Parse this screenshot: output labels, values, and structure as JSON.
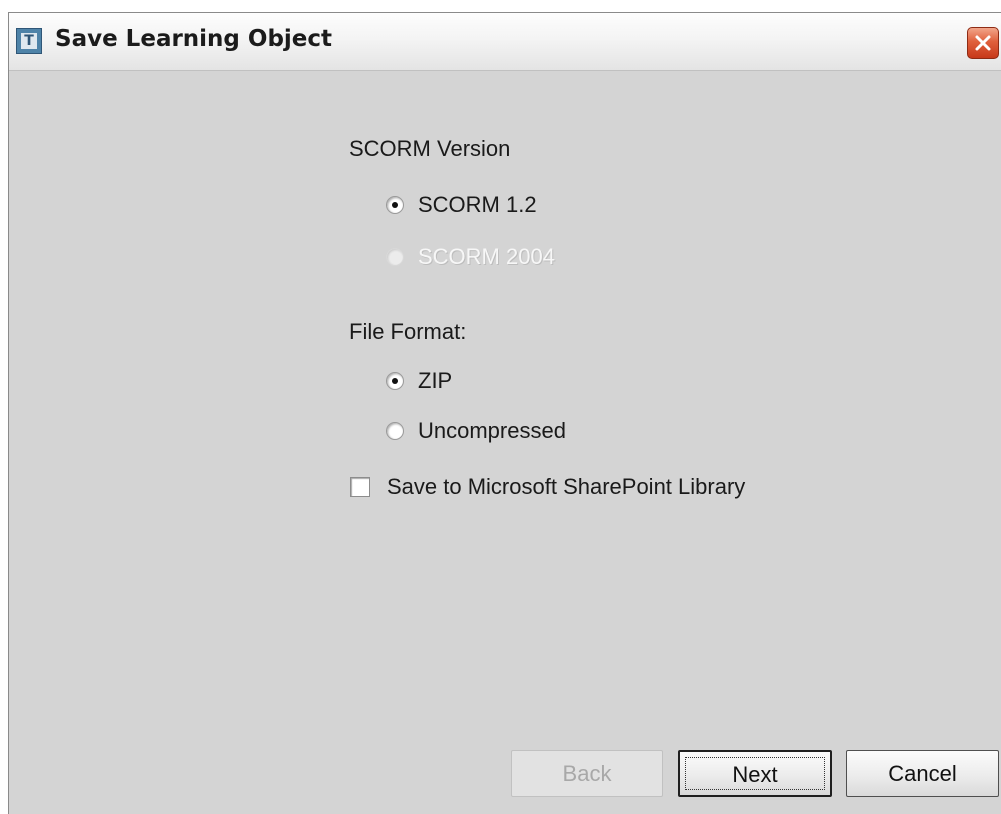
{
  "window": {
    "title": "Save Learning Object",
    "icon": "app-icon-t",
    "close_icon": "close-icon"
  },
  "scorm": {
    "heading": "SCORM Version",
    "options": [
      {
        "label": "SCORM 1.2",
        "checked": true,
        "enabled": true
      },
      {
        "label": "SCORM 2004",
        "checked": false,
        "enabled": false
      }
    ]
  },
  "file_format": {
    "heading": "File Format:",
    "options": [
      {
        "label": "ZIP",
        "checked": true,
        "enabled": true
      },
      {
        "label": "Uncompressed",
        "checked": false,
        "enabled": true
      }
    ]
  },
  "sharepoint": {
    "label": "Save to Microsoft SharePoint Library",
    "checked": false
  },
  "buttons": {
    "back": "Back",
    "next": "Next",
    "cancel": "Cancel"
  },
  "colors": {
    "dialog_bg": "#d4d4d4",
    "close_button": "#e0603c",
    "disabled_text": "#f7f7f7"
  }
}
